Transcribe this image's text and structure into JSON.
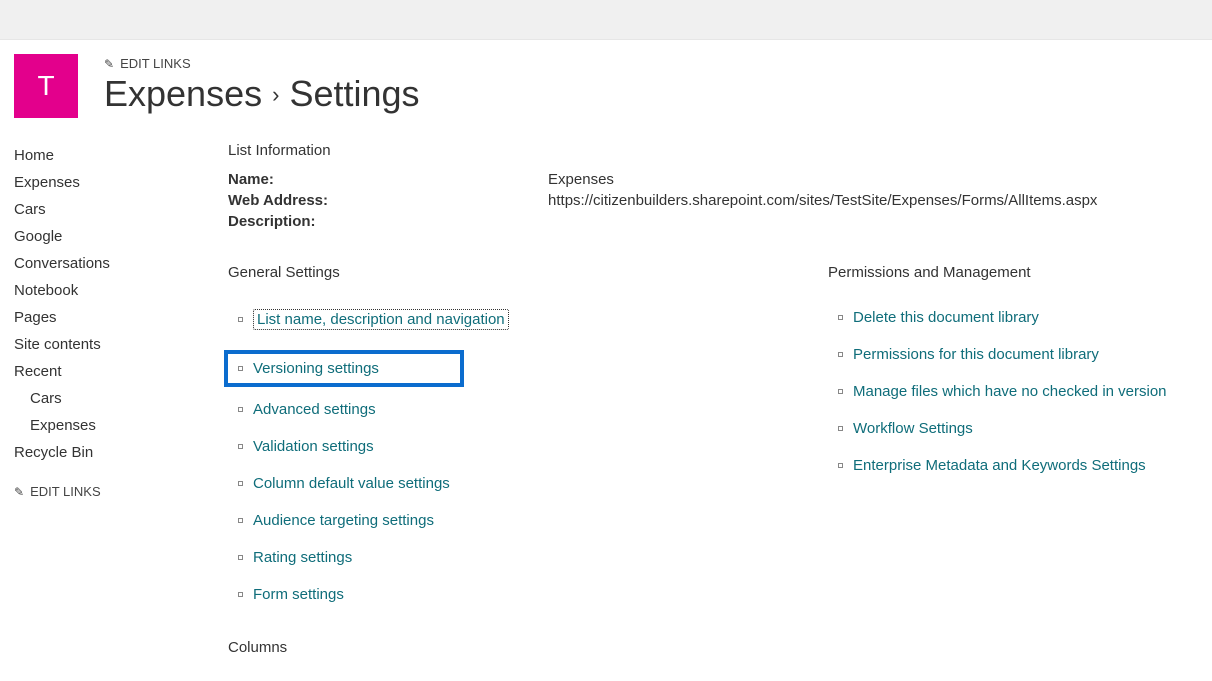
{
  "header": {
    "logo_letter": "T",
    "edit_links": "EDIT LINKS",
    "breadcrumb_library": "Expenses",
    "breadcrumb_sep": "›",
    "breadcrumb_current": "Settings"
  },
  "leftnav": {
    "items": [
      "Home",
      "Expenses",
      "Cars",
      "Google",
      "Conversations",
      "Notebook",
      "Pages",
      "Site contents",
      "Recent"
    ],
    "recent_sub": [
      "Cars",
      "Expenses"
    ],
    "recycle": "Recycle Bin",
    "edit_links": "EDIT LINKS"
  },
  "list_info": {
    "heading": "List Information",
    "name_label": "Name:",
    "name_value": "Expenses",
    "web_label": "Web Address:",
    "web_value": "https://citizenbuilders.sharepoint.com/sites/TestSite/Expenses/Forms/AllItems.aspx",
    "desc_label": "Description:"
  },
  "general": {
    "heading": "General Settings",
    "links": [
      "List name, description and navigation",
      "Versioning settings",
      "Advanced settings",
      "Validation settings",
      "Column default value settings",
      "Audience targeting settings",
      "Rating settings",
      "Form settings"
    ]
  },
  "permissions": {
    "heading": "Permissions and Management",
    "links": [
      "Delete this document library",
      "Permissions for this document library",
      "Manage files which have no checked in version",
      "Workflow Settings",
      "Enterprise Metadata and Keywords Settings"
    ]
  },
  "columns": {
    "heading": "Columns"
  }
}
